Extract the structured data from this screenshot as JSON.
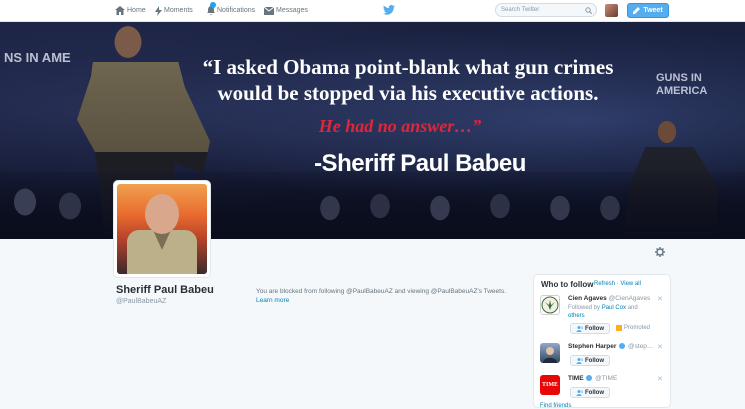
{
  "topbar": {
    "nav": [
      {
        "label": "Home",
        "icon": "home-icon"
      },
      {
        "label": "Moments",
        "icon": "lightning-icon"
      },
      {
        "label": "Notifications",
        "icon": "bell-icon"
      },
      {
        "label": "Messages",
        "icon": "envelope-icon"
      }
    ],
    "search_placeholder": "Search Twitter",
    "tweet_button": "Tweet"
  },
  "banner": {
    "quote_line1": "“I asked Obama point-blank what gun crimes",
    "quote_line2": "would be stopped via his executive actions.",
    "quote_red": "He had no answer…”",
    "attribution": "-Sheriff Paul Babeu",
    "bg_left_text": "NS IN AME",
    "bg_right_line1": "GUNS IN",
    "bg_right_line2": "AMERICA"
  },
  "profile": {
    "name": "Sheriff Paul Babeu",
    "handle": "@PaulBabeuAZ",
    "blocked_text": "You are blocked from following @PaulBabeuAZ and viewing @PaulBabeuAZ's Tweets.",
    "learn_more": "Learn more"
  },
  "who_to_follow": {
    "title": "Who to follow",
    "refresh": "Refresh",
    "view_all": "View all",
    "suggestions": [
      {
        "name": "Cien Agaves",
        "handle": "@CienAgaves",
        "followed_by": "Followed by",
        "followed_user": "Paul Cox",
        "and": "and",
        "others": "others",
        "button": "Follow",
        "promoted": "Promoted"
      },
      {
        "name": "Stephen Harper",
        "handle": "@step…",
        "button": "Follow"
      },
      {
        "name": "TIME",
        "handle": "@TIME",
        "button": "Follow"
      }
    ],
    "find_friends": "Find friends"
  },
  "colors": {
    "twitter_blue": "#55acee",
    "link": "#0084b4",
    "red_quote": "#e0263a"
  }
}
